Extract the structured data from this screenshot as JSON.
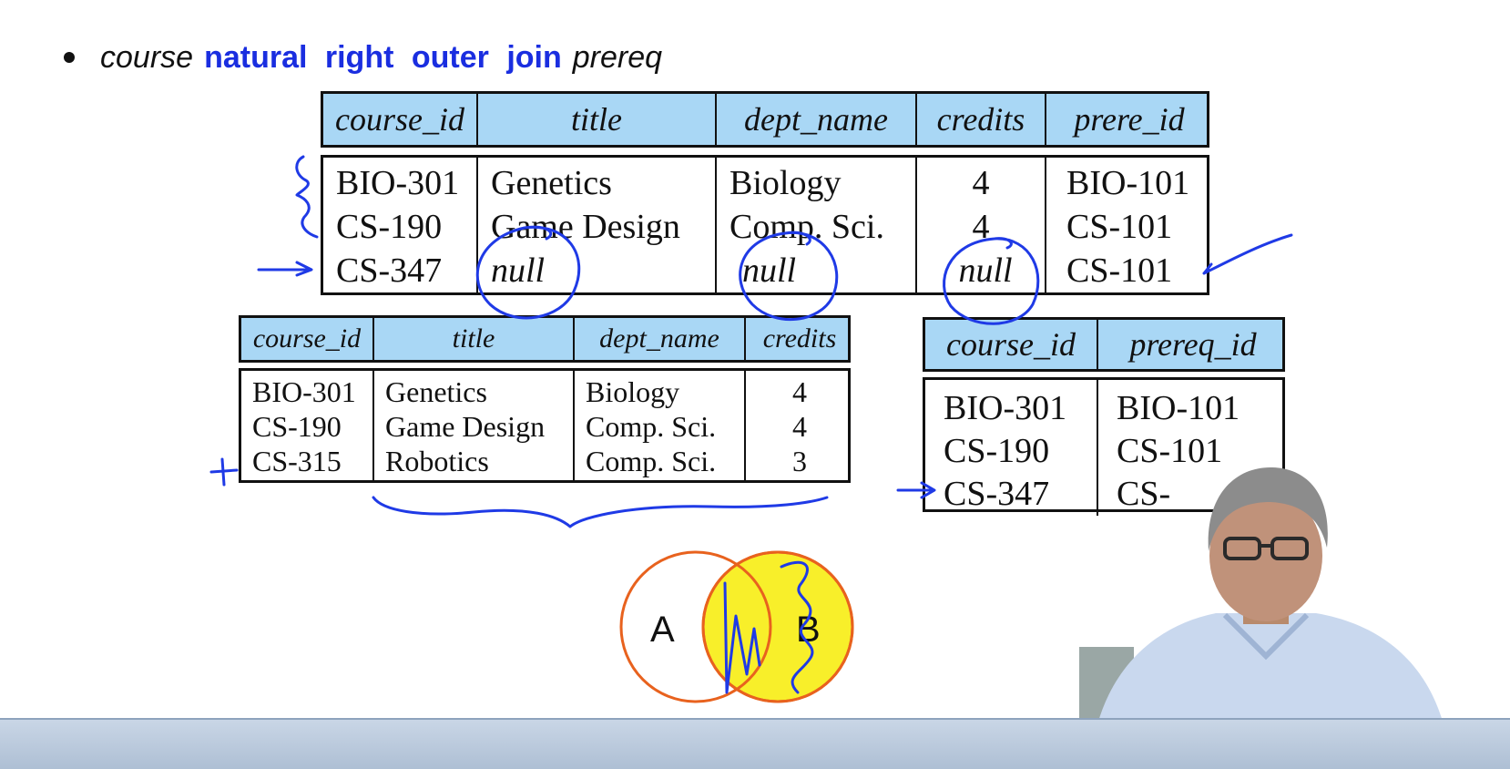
{
  "heading": {
    "left_relation": "course",
    "keywords": [
      "natural",
      "right",
      "outer",
      "join"
    ],
    "right_relation": "prereq"
  },
  "result_table": {
    "headers": [
      "course_id",
      "title",
      "dept_name",
      "credits",
      "prere_id"
    ],
    "columns": [
      [
        "BIO-301",
        "CS-190",
        "CS-347"
      ],
      [
        "Genetics",
        "Game Design",
        "null"
      ],
      [
        "Biology",
        "Comp. Sci.",
        "null"
      ],
      [
        "4",
        "4",
        "null"
      ],
      [
        "BIO-101",
        "CS-101",
        "CS-101"
      ]
    ]
  },
  "course_table": {
    "headers": [
      "course_id",
      "title",
      "dept_name",
      "credits"
    ],
    "columns": [
      [
        "BIO-301",
        "CS-190",
        "CS-315"
      ],
      [
        "Genetics",
        "Game Design",
        "Robotics"
      ],
      [
        "Biology",
        "Comp. Sci.",
        "Comp. Sci."
      ],
      [
        "4",
        "4",
        "3"
      ]
    ]
  },
  "prereq_table": {
    "headers": [
      "course_id",
      "prereq_id"
    ],
    "columns": [
      [
        "BIO-301",
        "CS-190",
        "CS-347"
      ],
      [
        "BIO-101",
        "CS-101",
        "CS-"
      ]
    ]
  },
  "venn": {
    "label_a": "A",
    "label_b": "B",
    "circle_stroke": "#e8621e",
    "b_fill": "#f8ef2a"
  },
  "colors": {
    "keyword": "#1a2ee0",
    "header_bg": "#a9d7f5",
    "ink": "#1f3ae6"
  }
}
